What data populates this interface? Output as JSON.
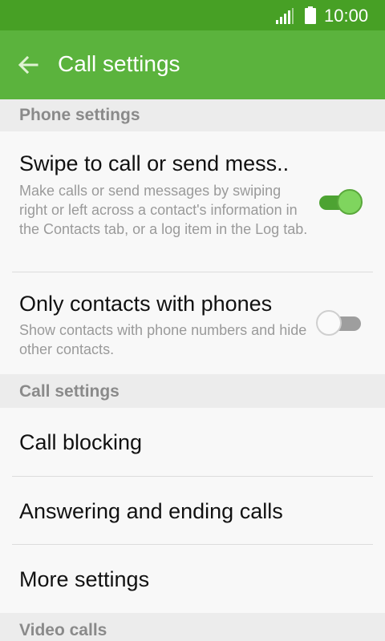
{
  "status_bar": {
    "time": "10:00",
    "signal_icon": "signal-icon",
    "battery_icon": "battery-icon"
  },
  "app_bar": {
    "title": "Call settings",
    "back_icon": "arrow-left-icon"
  },
  "sections": {
    "phone_settings": {
      "header": "Phone settings",
      "swipe": {
        "title": "Swipe to call or send mess..",
        "description": "Make calls or send messages by swiping right or left across a contact's information in the Contacts tab, or a log item in the Log tab.",
        "enabled": true
      },
      "only_contacts": {
        "title": "Only contacts with phones",
        "description": "Show contacts with phone numbers and hide other contacts.",
        "enabled": false
      }
    },
    "call_settings": {
      "header": "Call settings",
      "items": [
        {
          "label": "Call blocking"
        },
        {
          "label": "Answering and ending calls"
        },
        {
          "label": "More settings"
        }
      ]
    },
    "video_calls": {
      "header": "Video calls"
    }
  },
  "colors": {
    "status_bar": "#47a025",
    "app_bar": "#5bb33d",
    "accent": "#7fd55e",
    "section_header_bg": "#ececec",
    "section_header_text": "#8a8a8a"
  }
}
